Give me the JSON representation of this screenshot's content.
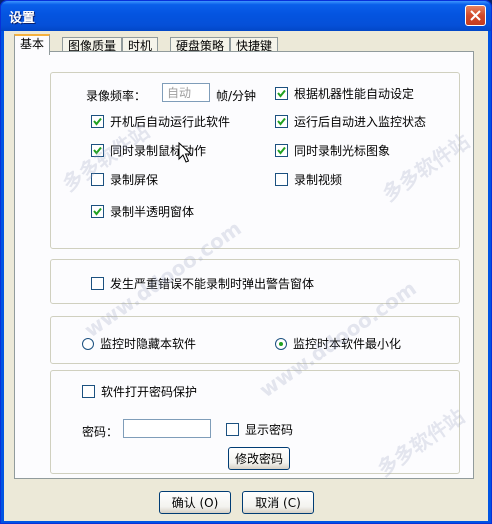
{
  "window": {
    "title": "设置"
  },
  "tabs": [
    {
      "label": "基本"
    },
    {
      "label": "图像质量"
    },
    {
      "label": "时机"
    },
    {
      "label": "硬盘策略"
    },
    {
      "label": "快捷键"
    }
  ],
  "basic": {
    "frame_rate_label": "录像频率：",
    "frame_rate_value": "自动",
    "frame_rate_unit": "帧/分钟",
    "auto_by_performance": "根据机器性能自动设定",
    "run_on_startup": "开机后自动运行此软件",
    "auto_monitor": "运行后自动进入监控状态",
    "record_mouse": "同时录制鼠标动作",
    "record_cursor_icon": "同时录制光标图象",
    "record_screensaver": "录制屏保",
    "record_video": "录制视频",
    "record_translucent": "录制半透明窗体"
  },
  "error_group": {
    "warn_on_error": "发生严重错误不能录制时弹出警告窗体"
  },
  "monitor_group": {
    "hide_software": "监控时隐藏本软件",
    "minimize_software": "监控时本软件最小化"
  },
  "password_group": {
    "enable_password": "软件打开密码保护",
    "password_label": "密码：",
    "show_password": "显示密码",
    "change_password": "修改密码"
  },
  "footer": {
    "ok": "确认 (O)",
    "cancel": "取消 (C)"
  },
  "watermarks": [
    "多多软件站",
    "www.ddooo.com",
    "多多软件站",
    "www.ddooo.com",
    "多多软件站"
  ],
  "colors": {
    "titlebar": "#0454e0",
    "dialog_bg": "#ece9d8",
    "tab_active_accent": "#f5b13d",
    "check": "#21a121"
  }
}
